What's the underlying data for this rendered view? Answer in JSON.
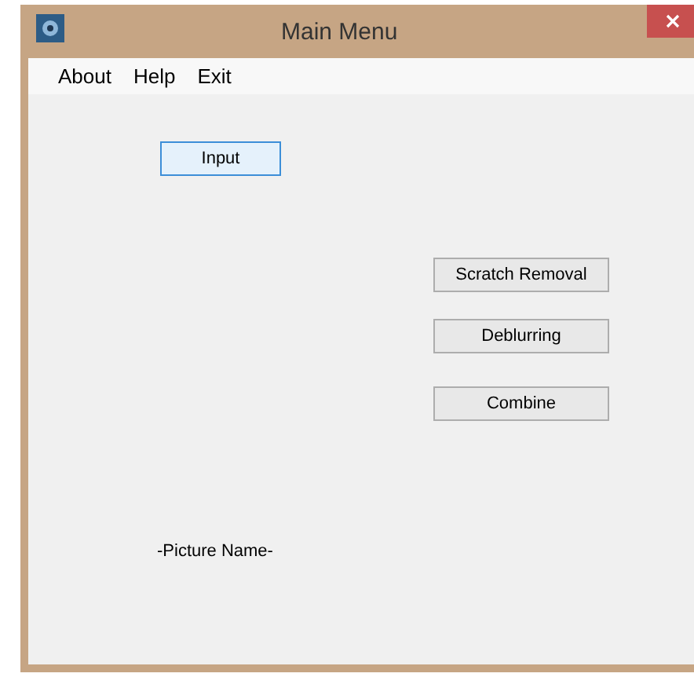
{
  "window": {
    "title": "Main Menu"
  },
  "menu": [
    "About",
    "Help",
    "Exit"
  ],
  "buttons": [
    {
      "label": "Input",
      "focused": true
    },
    {
      "label": "Scratch Removal",
      "focused": false
    },
    {
      "label": "Deblurring",
      "focused": false
    },
    {
      "label": "Combine",
      "focused": false
    }
  ],
  "picture_name": "-Picture Name-"
}
